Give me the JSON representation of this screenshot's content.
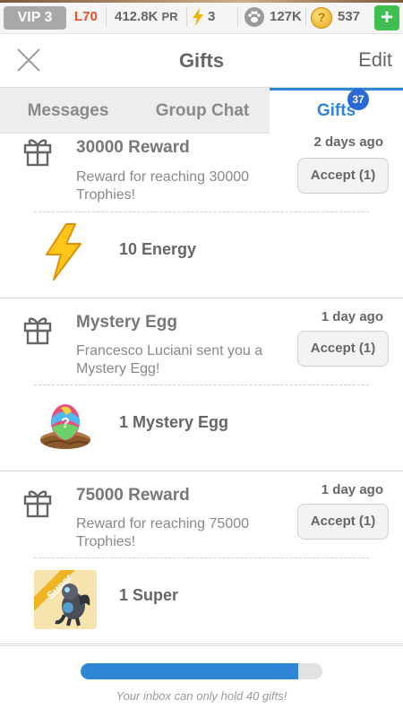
{
  "status_bar": {
    "vip": "VIP 3",
    "level": "L70",
    "trophies": "412.8K",
    "trophies_suffix": "PR",
    "energy": "3",
    "dragons": "127K",
    "gems": "537",
    "add_label": "+"
  },
  "header": {
    "title": "Gifts",
    "edit_label": "Edit"
  },
  "tabs": [
    {
      "label": "Messages",
      "active": false
    },
    {
      "label": "Group Chat",
      "active": false
    },
    {
      "label": "Gifts",
      "active": true,
      "badge": "37"
    }
  ],
  "gifts": [
    {
      "title": "30000 Reward",
      "time": "2 days ago",
      "description": "Reward for reaching 30000 Trophies!",
      "accept_label": "Accept (1)",
      "item_icon": "lightning-bolt-icon",
      "item_label": "10 Energy"
    },
    {
      "title": "Mystery Egg",
      "time": "1 day ago",
      "description": "Francesco Luciani sent you a Mystery Egg!",
      "accept_label": "Accept (1)",
      "item_icon": "mystery-egg-icon",
      "item_label": "1 Mystery Egg"
    },
    {
      "title": "75000 Reward",
      "time": "1 day ago",
      "description": "Reward for reaching 75000 Trophies!",
      "accept_label": "Accept (1)",
      "item_icon": "super-dragon-icon",
      "item_badge": "Super",
      "item_label": "1 Super"
    }
  ],
  "inbox": {
    "capacity": 40,
    "fill_fraction": 0.9,
    "note": "Your inbox can only hold 40 gifts!"
  },
  "colors": {
    "accent": "#2f86d6",
    "level_red": "#e8502a",
    "add_green": "#3fbf50",
    "badge_blue": "#2968d6"
  }
}
